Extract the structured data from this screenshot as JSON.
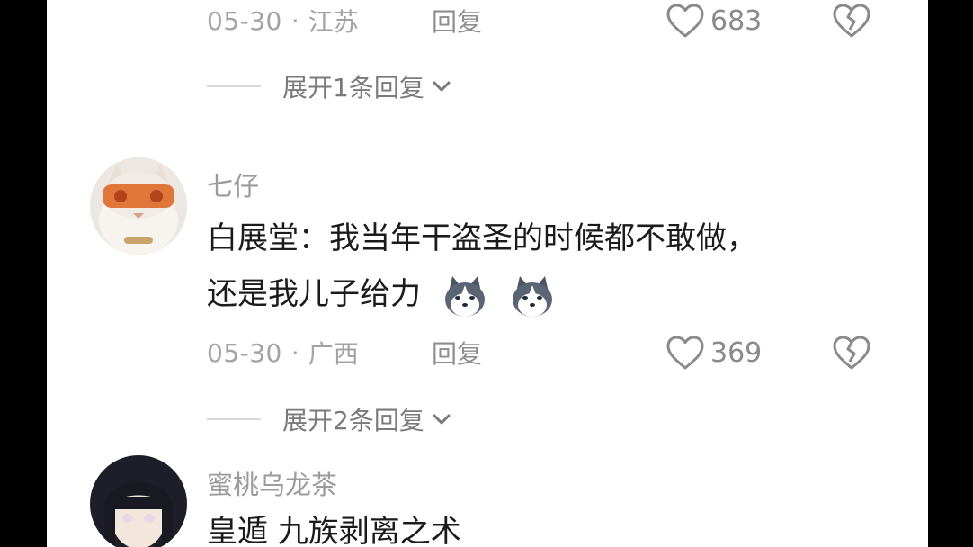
{
  "comments": [
    {
      "date": "05-30",
      "location": "江苏",
      "reply_label": "回复",
      "likes": "683",
      "expand_label": "展开1条回复"
    },
    {
      "username": "七仔",
      "content_line1": "白展堂：我当年干盗圣的时候都不敢做，",
      "content_line2": "还是我儿子给力",
      "emoji": [
        "husky-emoji",
        "husky-emoji"
      ],
      "date": "05-30",
      "location": "广西",
      "reply_label": "回复",
      "likes": "369",
      "expand_label": "展开2条回复"
    },
    {
      "username": "蜜桃乌龙茶",
      "content_line1": "皇遁 九族剥离之术"
    }
  ],
  "separator": "·",
  "colors": {
    "background": "#ffffff",
    "text_primary": "#1b1b1b",
    "text_secondary": "#a3a3a3"
  }
}
